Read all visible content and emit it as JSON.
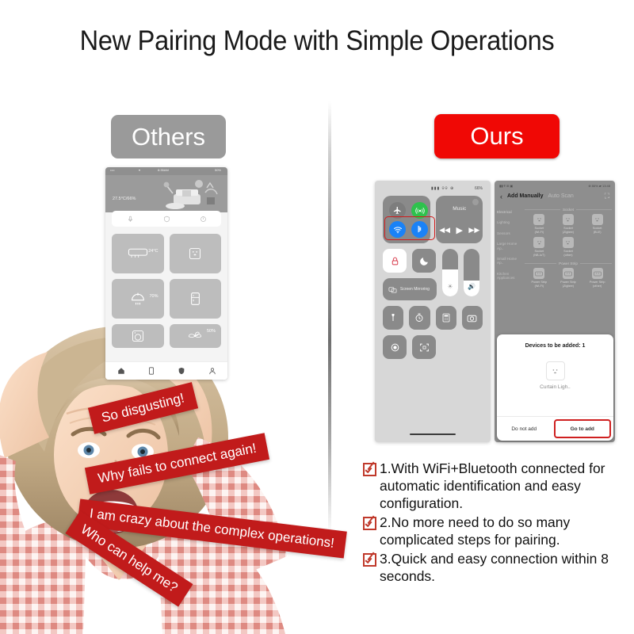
{
  "title": "New Pairing Mode with Simple Operations",
  "badges": {
    "others": "Others",
    "ours": "Ours"
  },
  "colors": {
    "brand_red": "#f00805",
    "banner_red": "#c11b1b",
    "gray": "#9a9a9a",
    "check_red": "#c0392b"
  },
  "left_phone": {
    "status": {
      "signal": "••••",
      "wifi": "wifi-icon",
      "time": "8:35AM",
      "battery": "50%"
    },
    "hero_temp": "27.5°C/66%",
    "quick_icons": [
      "mic-icon",
      "shield-icon",
      "power-icon"
    ],
    "tiles": [
      {
        "icon": "air-conditioner-icon",
        "value": "24°C"
      },
      {
        "icon": "socket-icon",
        "value": ""
      },
      {
        "icon": "humidifier-icon",
        "value": "70%"
      },
      {
        "icon": "refrigerator-icon",
        "value": ""
      },
      {
        "icon": "washing-machine-icon",
        "value": ""
      },
      {
        "icon": "fan-icon",
        "value": "50%"
      }
    ],
    "nav": [
      "home-icon",
      "device-icon",
      "shield-icon",
      "profile-icon"
    ]
  },
  "control_center": {
    "status_left": "signal-wifi-icons",
    "status_right": "66%",
    "connectivity": [
      {
        "name": "airplane-mode",
        "state": "off"
      },
      {
        "name": "cellular-data",
        "state": "on"
      },
      {
        "name": "wifi",
        "state": "on"
      },
      {
        "name": "bluetooth",
        "state": "on"
      }
    ],
    "music_label": "Music",
    "music_controls": [
      "prev-icon",
      "play-icon",
      "next-icon"
    ],
    "rotation_lock": "lock-icon",
    "do_not_disturb": "moon-icon",
    "screen_mirroring": "Screen Mirroring",
    "brightness_icon": "brightness-icon",
    "volume_icon": "volume-icon",
    "tools": [
      "flashlight-icon",
      "timer-icon",
      "calculator-icon",
      "camera-icon",
      "record-icon",
      "qr-scan-icon"
    ],
    "highlight_note": "wifi-and-bluetooth-highlighted"
  },
  "add_device": {
    "tab_active": "Add Manually",
    "tab_inactive": "Auto Scan",
    "back_icon": "chevron-left-icon",
    "scan_icon": "scan-icon",
    "categories": [
      "Electrical",
      "Lighting",
      "Sensors",
      "Large Home Ap..",
      "Small Home Ap..",
      "Kitchen Appliances"
    ],
    "sections": [
      {
        "name": "Socket",
        "items": [
          {
            "label1": "Socket",
            "label2": "(Wi-Fi)"
          },
          {
            "label1": "Socket",
            "label2": "(Zigbee)"
          },
          {
            "label1": "Socket",
            "label2": "(BLE)"
          },
          {
            "label1": "Socket",
            "label2": "(NB-IoT)"
          },
          {
            "label1": "Socket",
            "label2": "(other)"
          }
        ]
      },
      {
        "name": "Power Strip",
        "items": [
          {
            "label1": "Power Strip",
            "label2": "(Wi-Fi)"
          },
          {
            "label1": "Power Strip",
            "label2": "(Zigbee)"
          },
          {
            "label1": "Power Strip",
            "label2": "(other)"
          }
        ]
      }
    ]
  },
  "dialog": {
    "title": "Devices to be added: 1",
    "device_name": "Curtain Ligh..",
    "device_icon": "socket-icon",
    "cancel": "Do not add",
    "confirm": "Go to add"
  },
  "banners": [
    "So disgusting!",
    "Why fails to connect again!",
    "I am crazy about the complex operations!",
    "Who can help me?"
  ],
  "features": [
    "1.With WiFi+Bluetooth connected for automatic identification and easy configuration.",
    "2.No more need to do so many complicated steps for pairing.",
    "3.Quick and easy connection within 8 seconds."
  ]
}
